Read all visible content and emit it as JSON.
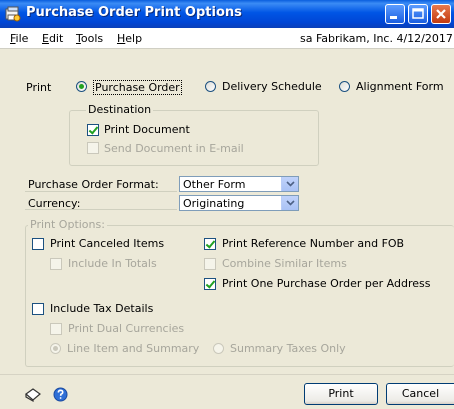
{
  "window": {
    "title": "Purchase Order Print Options"
  },
  "menu": {
    "items": [
      {
        "mn": "F",
        "rest": "ile"
      },
      {
        "mn": "E",
        "rest": "dit"
      },
      {
        "mn": "T",
        "rest": "ools"
      },
      {
        "mn": "H",
        "rest": "elp"
      }
    ],
    "info": "sa  Fabrikam, Inc.  4/12/2017"
  },
  "print": {
    "label": "Print",
    "options": [
      "Purchase Order",
      "Delivery Schedule",
      "Alignment Form"
    ],
    "selected": "Purchase Order"
  },
  "destination": {
    "title": "Destination",
    "print_document": {
      "label": "Print Document",
      "checked": true
    },
    "send_email": {
      "label": "Send Document in E-mail",
      "checked": false,
      "enabled": false
    }
  },
  "format": {
    "label": "Purchase Order Format:",
    "value": "Other Form"
  },
  "currency": {
    "label": "Currency:",
    "value": "Originating"
  },
  "print_options": {
    "title": "Print Options:",
    "print_canceled": {
      "label": "Print Canceled Items",
      "checked": false
    },
    "include_totals": {
      "label": "Include In Totals",
      "checked": false,
      "enabled": false
    },
    "print_ref_fob": {
      "label": "Print Reference Number and FOB",
      "checked": true
    },
    "combine_similar": {
      "label": "Combine Similar Items",
      "checked": false,
      "enabled": false
    },
    "one_po_per_address": {
      "label": "Print One Purchase Order per Address",
      "checked": true
    },
    "include_tax": {
      "label": "Include Tax Details",
      "checked": false
    },
    "dual_currencies": {
      "label": "Print Dual Currencies",
      "checked": false,
      "enabled": false
    },
    "line_item_summary": {
      "label": "Line Item and Summary",
      "selected": true,
      "enabled": false
    },
    "summary_taxes_only": {
      "label": "Summary Taxes Only",
      "selected": false,
      "enabled": false
    }
  },
  "buttons": {
    "print": "Print",
    "cancel": "Cancel"
  },
  "colors": {
    "titlebar": "#0055e5",
    "check": "#21a121",
    "window_bg": "#ece9d8"
  }
}
